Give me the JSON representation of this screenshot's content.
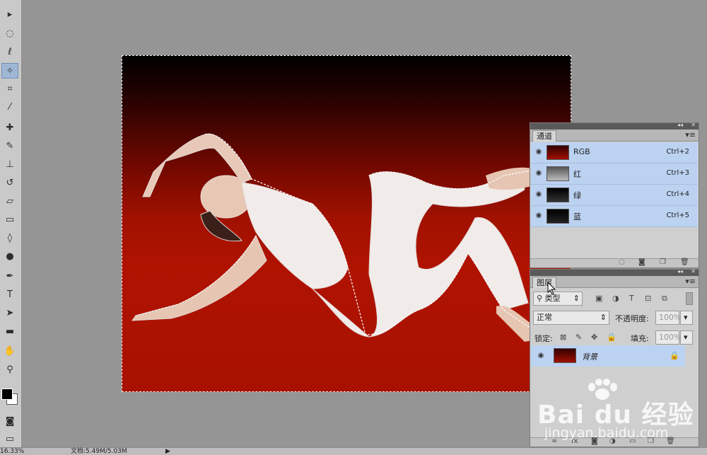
{
  "toolbar": {
    "tools": [
      {
        "name": "move-tool-icon",
        "glyph": "▸"
      },
      {
        "name": "marquee-tool-icon",
        "glyph": "◌"
      },
      {
        "name": "lasso-tool-icon",
        "glyph": "ℓ"
      },
      {
        "name": "magic-wand-tool-icon",
        "glyph": "✧"
      },
      {
        "name": "crop-tool-icon",
        "glyph": "⌗"
      },
      {
        "name": "eyedropper-tool-icon",
        "glyph": "⁄"
      },
      {
        "name": "healing-brush-tool-icon",
        "glyph": "✚"
      },
      {
        "name": "brush-tool-icon",
        "glyph": "✎"
      },
      {
        "name": "clone-stamp-tool-icon",
        "glyph": "⊥"
      },
      {
        "name": "history-brush-tool-icon",
        "glyph": "↺"
      },
      {
        "name": "eraser-tool-icon",
        "glyph": "▱"
      },
      {
        "name": "gradient-tool-icon",
        "glyph": "▭"
      },
      {
        "name": "blur-tool-icon",
        "glyph": "◊"
      },
      {
        "name": "dodge-tool-icon",
        "glyph": "●"
      },
      {
        "name": "pen-tool-icon",
        "glyph": "✒"
      },
      {
        "name": "type-tool-icon",
        "glyph": "T"
      },
      {
        "name": "path-selection-tool-icon",
        "glyph": "➤"
      },
      {
        "name": "rectangle-tool-icon",
        "glyph": "▬"
      },
      {
        "name": "hand-tool-icon",
        "glyph": "✋"
      },
      {
        "name": "zoom-tool-icon",
        "glyph": "⚲"
      }
    ],
    "active_tool": "magic-wand-tool-icon"
  },
  "statusbar": {
    "zoom": "16.33%",
    "doc_info": "文档:5.49M/5.03M",
    "arrow": "▶"
  },
  "channels_panel": {
    "tab_label": "通道",
    "rows": [
      {
        "name": "RGB",
        "shortcut": "Ctrl+2",
        "thumb": "rgb"
      },
      {
        "name": "红",
        "shortcut": "Ctrl+3",
        "thumb": "red"
      },
      {
        "name": "绿",
        "shortcut": "Ctrl+4",
        "thumb": "green"
      },
      {
        "name": "蓝",
        "shortcut": "Ctrl+5",
        "thumb": "blue"
      }
    ]
  },
  "layers_panel": {
    "tab_label": "图层",
    "filter_label": "类型",
    "blend_mode": "正常",
    "opacity_label": "不透明度:",
    "opacity_value": "100%",
    "lock_label": "锁定:",
    "fill_label": "填充:",
    "fill_value": "100%",
    "layer_name": "背景"
  },
  "watermark": {
    "brand": "Bai  du 经验",
    "url": "jingyan.baidu.com"
  },
  "colors": {
    "selected_row": "#bcd2f1",
    "canvas_red": "#b01200"
  }
}
